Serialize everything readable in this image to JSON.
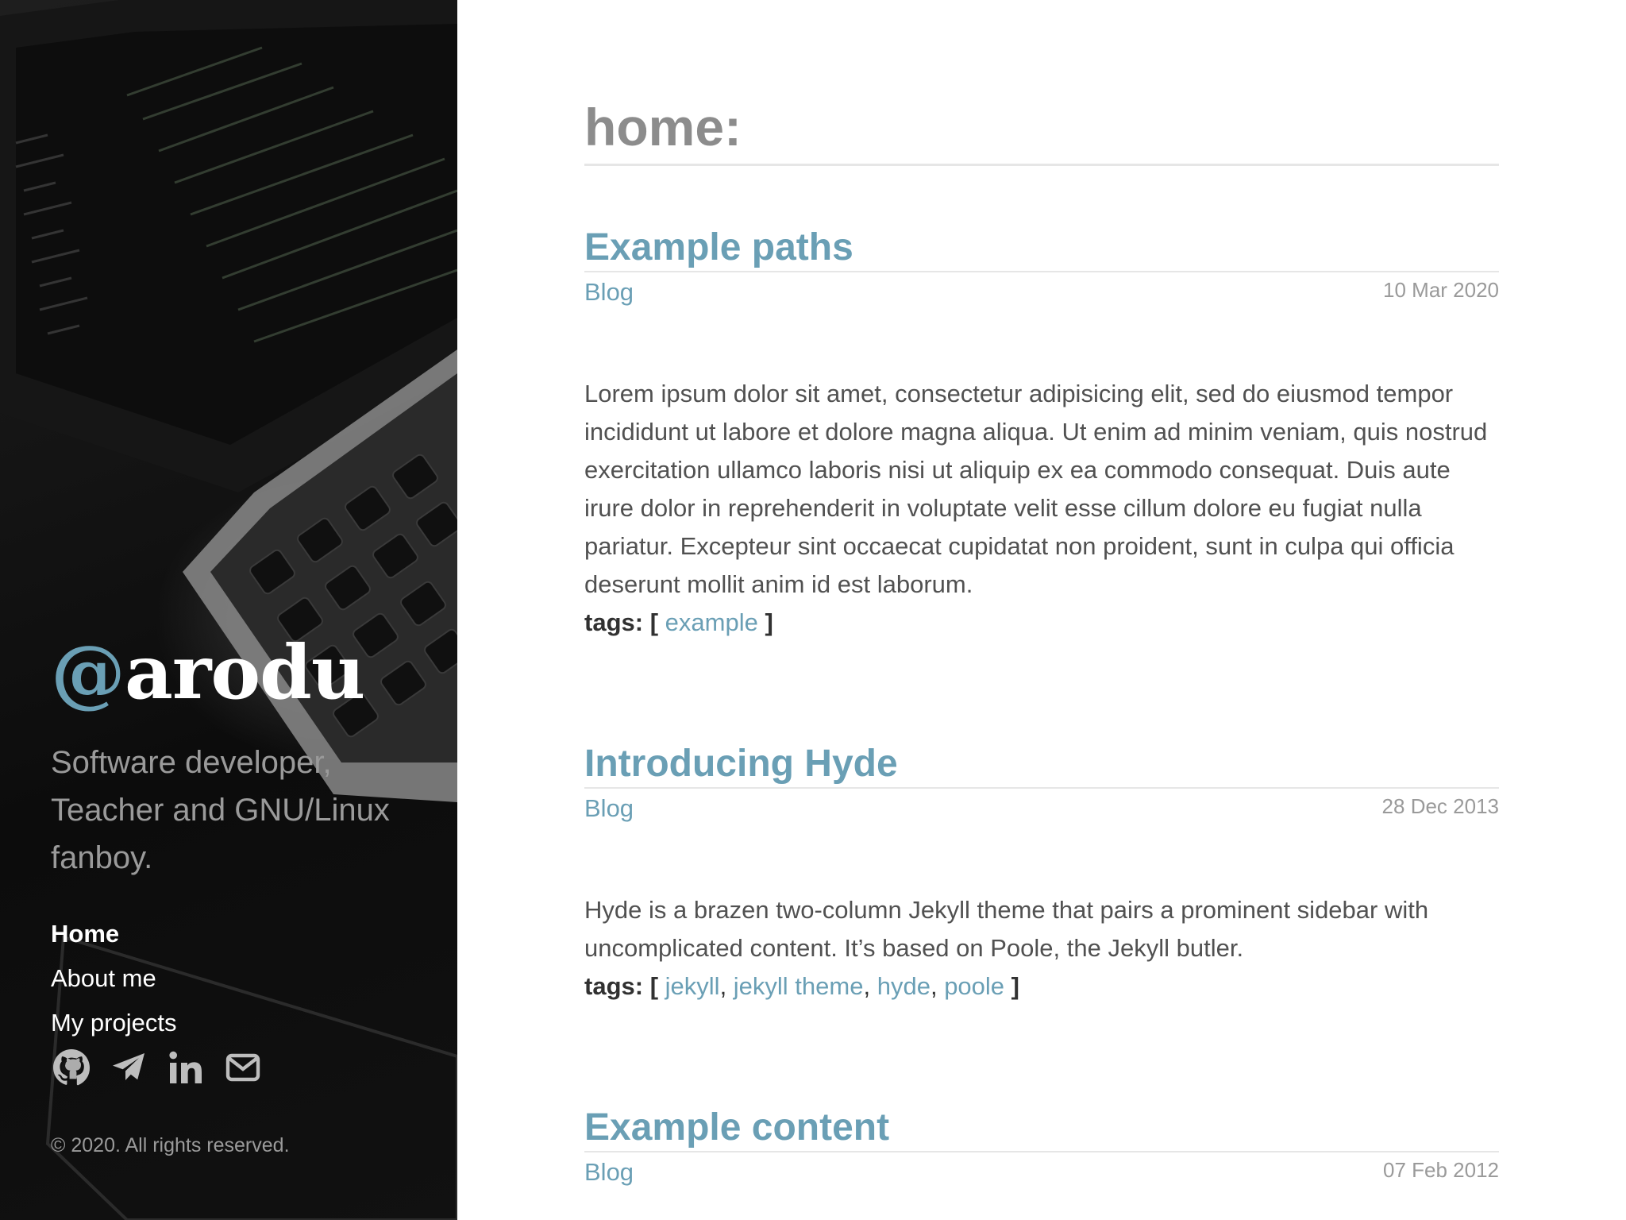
{
  "sidebar": {
    "brand_at": "@",
    "brand_name": "arodu",
    "tagline": "Software developer, Teacher and GNU/Linux fanboy.",
    "nav": [
      {
        "label": "Home",
        "active": true
      },
      {
        "label": "About me",
        "active": false
      },
      {
        "label": "My projects",
        "active": false
      }
    ],
    "social_icons": [
      "github-icon",
      "telegram-icon",
      "linkedin-icon",
      "email-icon"
    ],
    "copyright": "© 2020. All rights reserved."
  },
  "main": {
    "page_title": "home:",
    "tags_label": "tags:",
    "posts": [
      {
        "title": "Example paths",
        "category": "Blog",
        "date": "10 Mar 2020",
        "excerpt": "Lorem ipsum dolor sit amet, consectetur adipisicing elit, sed do eiusmod tempor incididunt ut labore et dolore magna aliqua. Ut enim ad minim veniam, quis nostrud exercitation ullamco laboris nisi ut aliquip ex ea commodo consequat. Duis aute irure dolor in reprehenderit in voluptate velit esse cillum dolore eu fugiat nulla pariatur. Excepteur sint occaecat cupidatat non proident, sunt in culpa qui officia deserunt mollit anim id est laborum.",
        "tags": [
          "example"
        ]
      },
      {
        "title": "Introducing Hyde",
        "category": "Blog",
        "date": "28 Dec 2013",
        "excerpt": "Hyde is a brazen two-column Jekyll theme that pairs a prominent sidebar with uncomplicated content. It’s based on Poole, the Jekyll butler.",
        "tags": [
          "jekyll",
          "jekyll theme",
          "hyde",
          "poole"
        ]
      },
      {
        "title": "Example content",
        "category": "Blog",
        "date": "07 Feb 2012"
      }
    ]
  },
  "colors": {
    "accent": "#6a9fb5",
    "sidebar_bg": "#111111",
    "muted": "#9a9a9a",
    "body_text": "#515151"
  }
}
